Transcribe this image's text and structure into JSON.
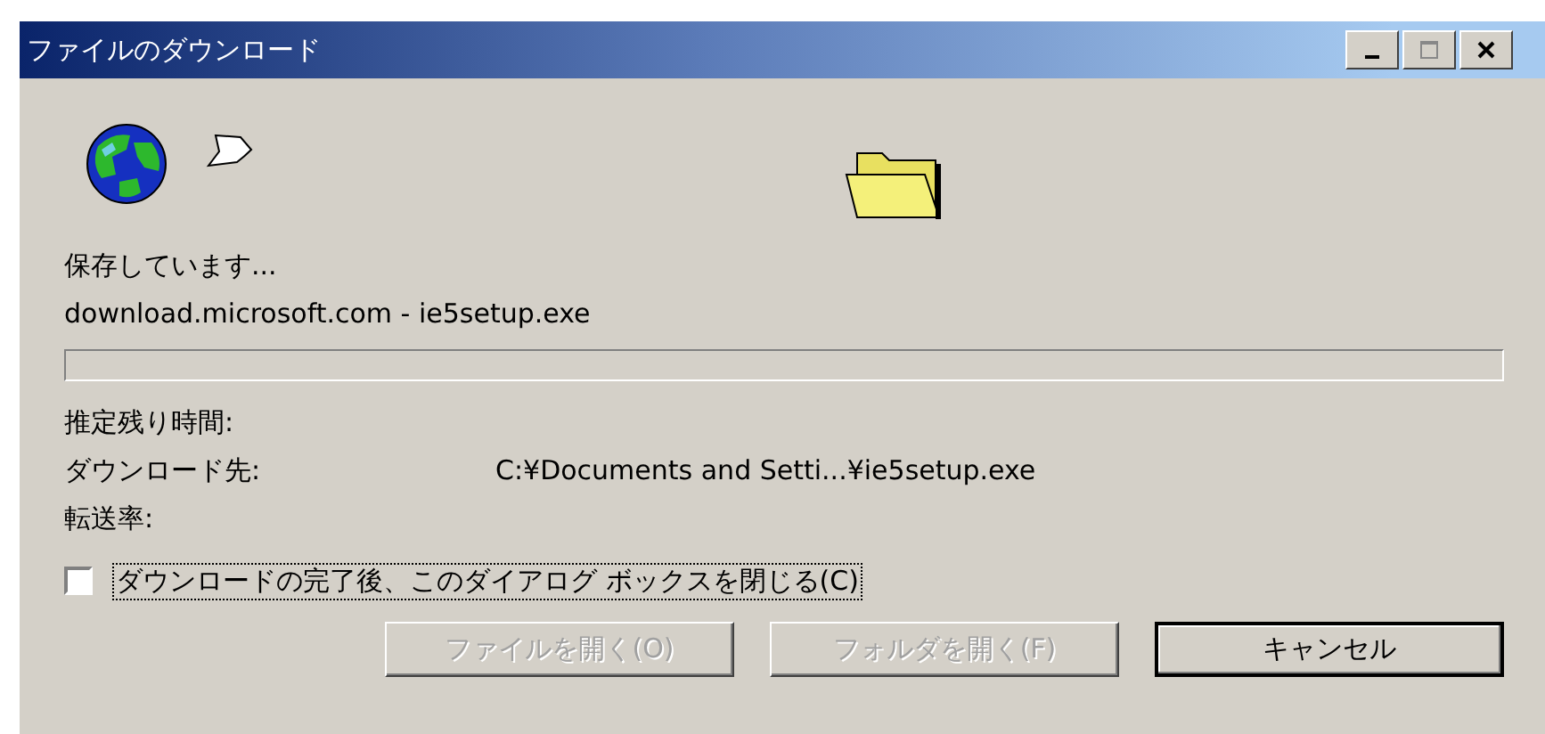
{
  "window": {
    "title": "ファイルのダウンロード"
  },
  "status": "保存しています...",
  "source": "download.microsoft.com - ie5setup.exe",
  "progress": {
    "level": 0
  },
  "details": [
    {
      "label": "推定残り時間:"
    },
    {
      "label": "ダウンロード先:",
      "value": "C:¥Documents and Setti...¥ie5setup.exe"
    },
    {
      "label": "転送率:"
    }
  ],
  "close_checkbox": {
    "label": "ダウンロードの完了後、このダイアログ ボックスを閉じる(C)",
    "checked": false
  },
  "buttons": [
    {
      "label": "ファイルを開く(O)",
      "disabled": true
    },
    {
      "label": "フォルダを開く(F)",
      "disabled": true
    },
    {
      "label": "キャンセル",
      "disabled": false
    }
  ]
}
